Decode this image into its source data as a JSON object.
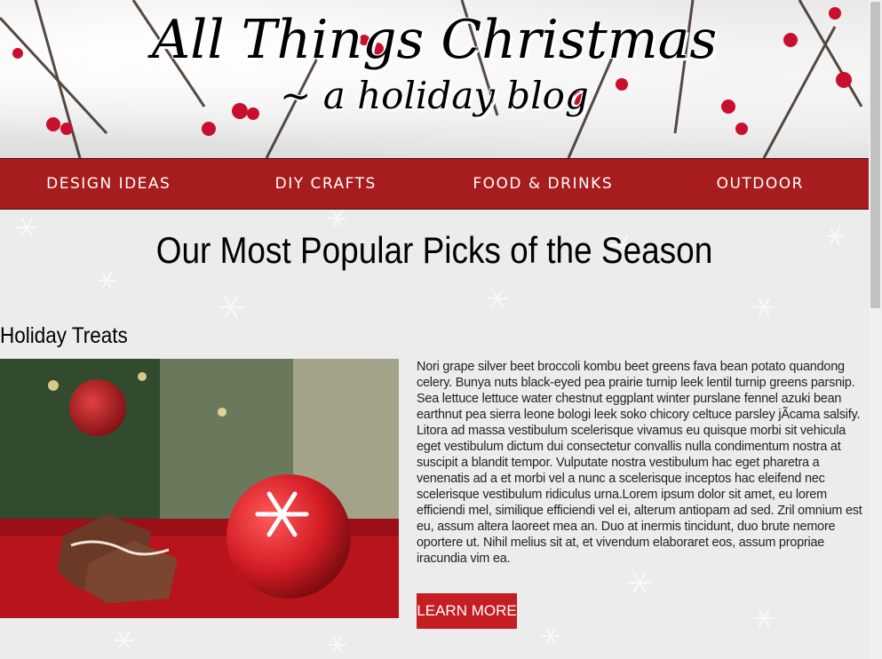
{
  "header": {
    "title": "All Things Christmas",
    "subtitle": "~ a holiday blog"
  },
  "nav": {
    "items": [
      {
        "label": "DESIGN IDEAS"
      },
      {
        "label": "DIY CRAFTS"
      },
      {
        "label": "FOOD & DRINKS"
      },
      {
        "label": "OUTDOOR"
      }
    ]
  },
  "main": {
    "section_title": "Our Most Popular Picks of the Season",
    "treats": {
      "title": "Holiday Treats",
      "body": "Nori grape silver beet broccoli kombu beet greens fava bean potato quandong celery. Bunya nuts black-eyed pea prairie turnip leek lentil turnip greens parsnip. Sea lettuce lettuce water chestnut eggplant winter purslane fennel azuki bean earthnut pea sierra leone bologi leek soko chicory celtuce parsley jÃcama salsify. Litora ad massa vestibulum scelerisque vivamus eu quisque morbi sit vehicula eget vestibulum dictum dui consectetur convallis nulla condimentum nostra at suscipit a blandit tempor. Vulputate nostra vestibulum hac eget pharetra a venenatis ad a et morbi vel a nunc a scelerisque inceptos hac eleifend nec scelerisque vestibulum ridiculus urna.Lorem ipsum dolor sit amet, eu lorem efficiendi mel, similique efficiendi vel ei, alterum antiopam ad sed. Zril omnium est eu, assum altera laoreet mea an. Duo at inermis tincidunt, duo brute nemore oportere ut. Nihil melius sit at, et vivendum elaboraret eos, assum propriae iracundia vim ea.",
      "button_label": "LEARN MORE"
    }
  },
  "colors": {
    "nav_background": "#a71d1d",
    "button_background": "#c41d22",
    "page_background": "#ececec"
  }
}
